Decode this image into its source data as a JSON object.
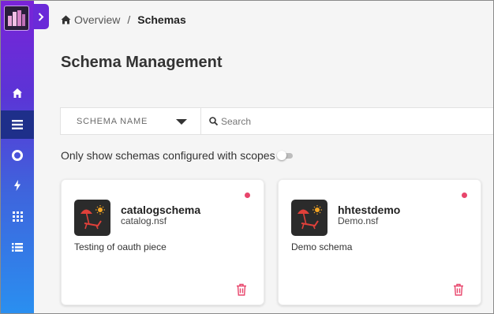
{
  "sidebar": {
    "logo": "app-logo",
    "items": [
      {
        "name": "home",
        "icon": "home-icon",
        "active": false
      },
      {
        "name": "schemas",
        "icon": "list-icon",
        "active": true
      },
      {
        "name": "settings",
        "icon": "circle-icon",
        "active": false
      },
      {
        "name": "activity",
        "icon": "bolt-icon",
        "active": false
      },
      {
        "name": "apps",
        "icon": "grid-icon",
        "active": false
      },
      {
        "name": "lists",
        "icon": "bullet-list-icon",
        "active": false
      }
    ]
  },
  "breadcrumb": {
    "home_label": "Overview",
    "separator": "/",
    "current": "Schemas"
  },
  "page": {
    "title": "Schema Management"
  },
  "filter": {
    "selected": "SCHEMA NAME"
  },
  "search": {
    "placeholder": "Search"
  },
  "scope_toggle": {
    "label": "Only show schemas configured with scopes",
    "enabled": false
  },
  "schemas": [
    {
      "name": "catalogschema",
      "file": "catalog.nsf",
      "description": "Testing of oauth piece",
      "status_color": "#e8456b"
    },
    {
      "name": "hhtestdemo",
      "file": "Demo.nsf",
      "description": "Demo schema",
      "status_color": "#e8456b"
    }
  ],
  "colors": {
    "accent": "#6a2ad8",
    "delete": "#e8456b",
    "active_nav": "#1e2f8a"
  }
}
